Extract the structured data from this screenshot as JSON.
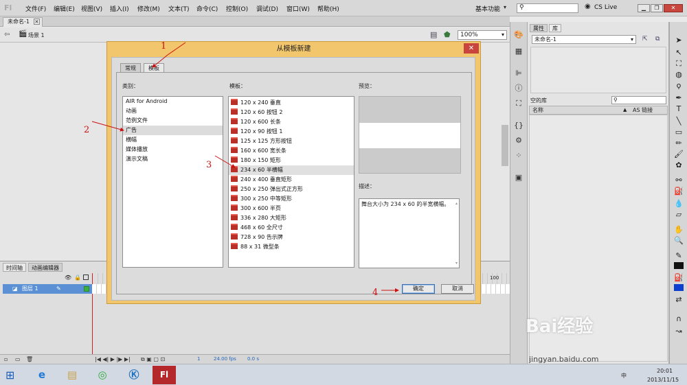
{
  "app": {
    "logo": "Fl",
    "menus": [
      "文件(F)",
      "编辑(E)",
      "视图(V)",
      "插入(I)",
      "修改(M)",
      "文本(T)",
      "命令(C)",
      "控制(O)",
      "调试(D)",
      "窗口(W)",
      "帮助(H)"
    ],
    "workspace": "基本功能",
    "cs_live": "CS Live"
  },
  "document": {
    "tab": "未命名-1",
    "scene": "场景 1",
    "zoom": "100%"
  },
  "timeline": {
    "tabs": [
      "时间轴",
      "动画编辑器"
    ],
    "layer_name": "图层 1",
    "frame_marker": "100",
    "frame": "1",
    "fps": "24.00 fps",
    "time": "0.0 s"
  },
  "library": {
    "tabs": [
      "属性",
      "库"
    ],
    "doc": "未命名-1",
    "empty_label": "空的库",
    "col_name": "名称",
    "col_linkage": "AS 链接"
  },
  "dialog": {
    "title": "从模板新建",
    "tabs": [
      "常规",
      "模板"
    ],
    "category_label": "类别：",
    "template_label": "模板：",
    "preview_label": "预览：",
    "desc_label": "描述：",
    "categories": [
      "AIR for Android",
      "动画",
      "范例文件",
      "广告",
      "横幅",
      "媒体播放",
      "演示文稿"
    ],
    "selected_category": 3,
    "templates": [
      "120 x 240 垂直",
      "120 x 60 按钮 2",
      "120 x 600 长条",
      "120 x 90 按钮 1",
      "125 x 125 方形按钮",
      "160 x 600 宽长条",
      "180 x 150 矩形",
      "234 x 60 半横幅",
      "240 x 400 垂直矩形",
      "250 x 250 弹出式正方形",
      "300 x 250 中等矩形",
      "300 x 600 半页",
      "336 x 280 大矩形",
      "468 x 60 全尺寸",
      "728 x 90 告示牌",
      "88 x 31 微型条"
    ],
    "selected_template": 7,
    "description": "舞台大小为 234 x 60 的半宽横幅。",
    "ok": "确定",
    "cancel": "取消"
  },
  "annotations": [
    "1",
    "2",
    "3",
    "4"
  ],
  "taskbar": {
    "time": "20:01",
    "date": "2013/11/15",
    "ime": "中"
  },
  "watermark": {
    "brand": "Bai经验",
    "url": "jingyan.baidu.com"
  },
  "colors": {
    "dialog_frame": "#f2c66c",
    "annotation": "#cc1111",
    "layer_selected": "#5b91d4"
  }
}
